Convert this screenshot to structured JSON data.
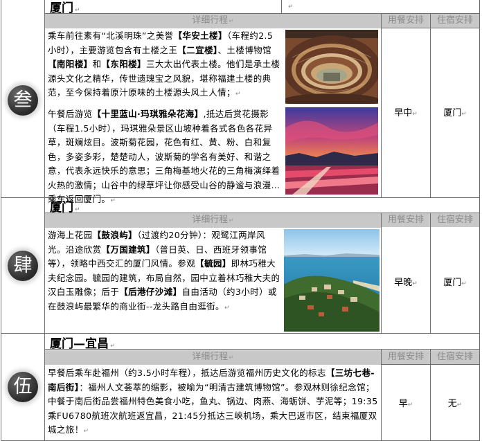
{
  "days": [
    {
      "numeral": "叁",
      "title": "厦门",
      "header": {
        "detail": "详细行程",
        "meal": "用餐安排",
        "lodging": "住宿安排"
      },
      "paragraphs": [
        [
          {
            "t": "乘车前往素有“北溪明珠”之美誉"
          },
          {
            "t": "【华安土楼】",
            "b": true
          },
          {
            "t": "（车程约2.5小时），主要游览包含有土楼之王"
          },
          {
            "t": "【二宜楼】",
            "b": true
          },
          {
            "t": "、土楼博物馆"
          },
          {
            "t": "【南阳楼】",
            "b": true
          },
          {
            "t": "和"
          },
          {
            "t": "【东阳楼】",
            "b": true
          },
          {
            "t": "三大太出代表土楼。他们是承土楼源头文化之精华，传世遗瑰宝之风貌，堪称福建土楼的典范，至今保持着原汁原味的土楼源头风土人情；"
          }
        ],
        [
          {
            "t": "午餐后游览"
          },
          {
            "t": "【十里蓝山·玛琪雅朵花海】",
            "b": true
          },
          {
            "t": ",抵达后赏花摄影（车程1.5小时），玛琪雅朵景区山坡种着各式各色各花异草，斑斓炫目。波斯菊花园，花色有红、黄、粉、白和复色，多姿多彩，楚楚动人，波斯菊的学名有美好、和谐之意，代表永远快乐的意思；三角梅基地火花的三角梅演绎着火热的激情；山谷中的绿草坪让你感受山谷的静谧与浪漫…乘车返回厦门。"
          }
        ]
      ],
      "meal": "早中",
      "lodging": "厦门"
    },
    {
      "numeral": "肆",
      "title": "厦门",
      "header": {
        "detail": "详细行程",
        "meal": "用餐安排",
        "lodging": "住宿安排"
      },
      "paragraphs": [
        [
          {
            "t": "游海上花园"
          },
          {
            "t": "【鼓浪屿】",
            "b": true
          },
          {
            "t": "（过渡约20分钟）：观鹭江两岸风光。沿途欣赏"
          },
          {
            "t": "【万国建筑】",
            "b": true
          },
          {
            "t": "（普日英、日、西班牙领事馆等），领略中西交汇的厦门风情。参观"
          },
          {
            "t": "【毓园】",
            "b": true
          },
          {
            "t": "即林巧稚大夫纪念园。毓园的建筑，布局自然，园中立着林巧稚大夫的汉白玉雕像；后于"
          },
          {
            "t": "【后港仔沙滩】",
            "b": true
          },
          {
            "t": "自由活动（约3小时）或在鼓浪屿最繁华的商业街--龙头路自由逛街。"
          }
        ]
      ],
      "meal": "早晚",
      "lodging": "厦门"
    },
    {
      "numeral": "伍",
      "title": "厦门—宜昌",
      "header": {
        "detail": "详细行程",
        "meal": "用餐安排",
        "lodging": "住宿安排"
      },
      "paragraphs": [
        [
          {
            "t": "早餐后乘车赴福州（约3.5小时车程），抵达后游览福州历史文化的标志"
          },
          {
            "t": "【三坊七巷-南后街】",
            "b": true
          },
          {
            "t": "：福州人文荟萃的缩影，被喻为“明清古建筑博物馆”。参观林则徐纪念馆；中餐于南后街品尝福州特色美食小吃，鱼丸、锅边、肉燕、海蛎饼、芋泥等；19:35乘FU6780航班次航班返宜昌，21:45分抵达三峡机场，乘大巴返市区，结束福厦双城之旅！"
          }
        ]
      ],
      "meal": "早",
      "lodging": "无"
    }
  ],
  "photos": [
    {
      "name": "tulou-photo",
      "subject": "土楼"
    },
    {
      "name": "flower-sea-photo",
      "subject": "花海"
    },
    {
      "name": "gulangyu-photo",
      "subject": "鼓浪屿"
    }
  ]
}
